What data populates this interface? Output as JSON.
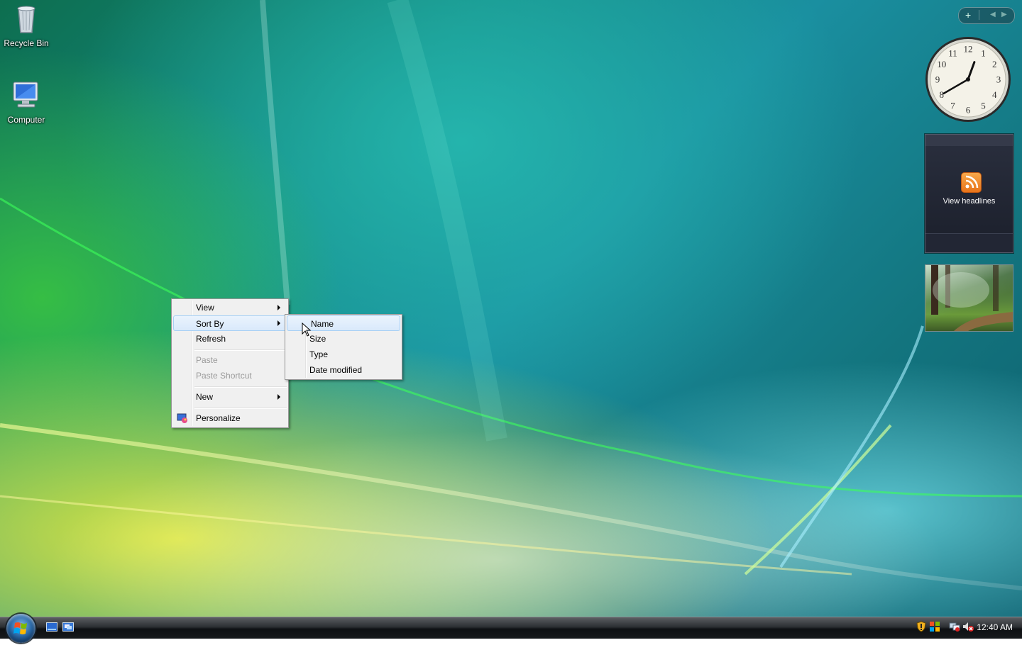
{
  "desktop": {
    "icons": [
      {
        "label": "Recycle Bin",
        "icon": "recycle-bin-icon"
      },
      {
        "label": "Computer",
        "icon": "computer-icon"
      }
    ]
  },
  "gadgets": {
    "toolbar": {
      "add_icon": "plus-icon",
      "prev_icon": "chevron-left-icon",
      "next_icon": "chevron-right-icon"
    },
    "clock": {
      "numerals": [
        "12",
        "1",
        "2",
        "3",
        "4",
        "5",
        "6",
        "7",
        "8",
        "9",
        "10",
        "11"
      ],
      "time": "12:40"
    },
    "feed": {
      "label": "View headlines",
      "icon": "rss-icon"
    },
    "slideshow": {
      "icon": "forest-photo"
    }
  },
  "context_menu": {
    "items": [
      {
        "label": "View",
        "submenu": true,
        "enabled": true
      },
      {
        "label": "Sort By",
        "submenu": true,
        "enabled": true,
        "highlighted": true
      },
      {
        "label": "Refresh",
        "submenu": false,
        "enabled": true
      },
      {
        "label": "Paste",
        "submenu": false,
        "enabled": false
      },
      {
        "label": "Paste Shortcut",
        "submenu": false,
        "enabled": false
      },
      {
        "label": "New",
        "submenu": true,
        "enabled": true
      },
      {
        "label": "Personalize",
        "submenu": false,
        "enabled": true,
        "icon": "personalize-icon"
      }
    ]
  },
  "sort_submenu": {
    "items": [
      {
        "label": "Name",
        "highlighted": true
      },
      {
        "label": "Size"
      },
      {
        "label": "Type"
      },
      {
        "label": "Date modified"
      }
    ]
  },
  "taskbar": {
    "start_icon": "windows-logo-icon",
    "quick_launch": [
      "show-desktop-icon",
      "switch-windows-icon"
    ],
    "tray_icons": [
      "security-shield-icon",
      "windows-flag-icon",
      "network-icon",
      "volume-muted-icon"
    ],
    "clock": "12:40 AM"
  },
  "colors": {
    "menu_bg": "#f0f0f0",
    "menu_highlight": "#d9e9fb",
    "taskbar": "#16191c"
  }
}
